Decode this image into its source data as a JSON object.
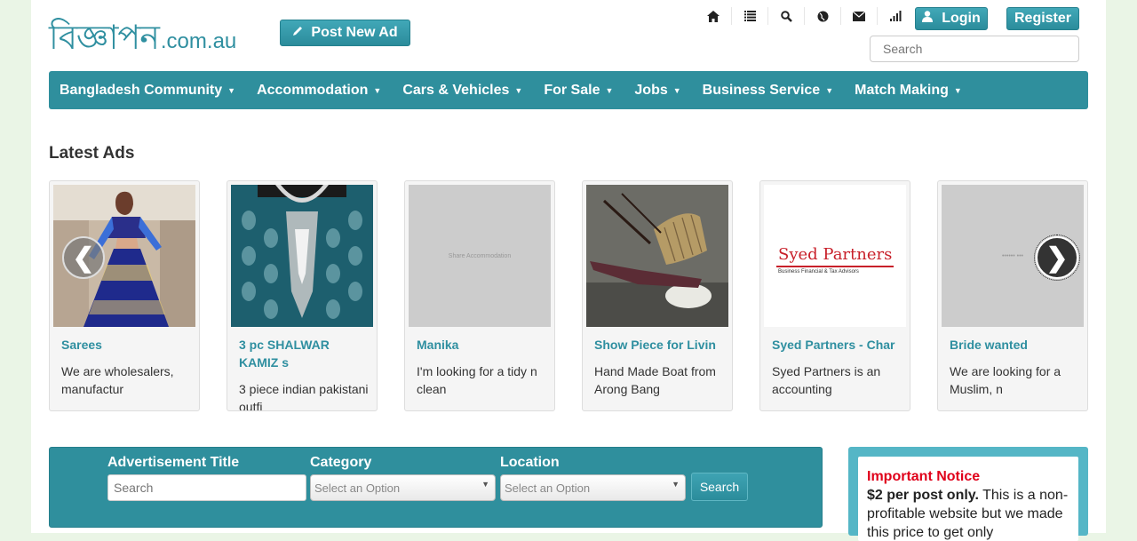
{
  "header": {
    "logo_bengali": "বিজ্ঞাপন",
    "logo_domain": ".com.au",
    "post_ad_label": "Post New Ad",
    "login_label": "Login",
    "register_label": "Register",
    "search_placeholder": "Search",
    "icons": [
      "home-icon",
      "list-icon",
      "search-icon",
      "globe-icon",
      "mail-icon",
      "signal-icon"
    ]
  },
  "nav": {
    "items": [
      {
        "label": "Bangladesh Community"
      },
      {
        "label": "Accommodation"
      },
      {
        "label": "Cars & Vehicles"
      },
      {
        "label": "For Sale"
      },
      {
        "label": "Jobs"
      },
      {
        "label": "Business Service"
      },
      {
        "label": "Match Making"
      }
    ]
  },
  "latest": {
    "title": "Latest Ads",
    "ads": [
      {
        "title": "Sarees",
        "desc": "We are wholesalers, manufactur"
      },
      {
        "title": "3 pc SHALWAR KAMIZ s",
        "desc": "3 piece indian pakistani outfi"
      },
      {
        "title": "Manika",
        "desc": "I'm looking for a tidy n clean",
        "image_text": "Share Accommodation"
      },
      {
        "title": "Show Piece for Livin",
        "desc": "Hand Made Boat from Arong Bang"
      },
      {
        "title": "Syed Partners - Char",
        "desc": "Syed Partners is an accounting",
        "logo_main": "Syed Partners",
        "logo_sub": "Business Financial & Tax Advisors"
      },
      {
        "title": "Bride wanted",
        "desc": "We are looking for a Muslim, n",
        "image_text": "•••••• •••"
      }
    ]
  },
  "search_panel": {
    "title_label": "Advertisement Title",
    "title_placeholder": "Search",
    "category_label": "Category",
    "category_value": "Select an Option",
    "location_label": "Location",
    "location_value": "Select an Option",
    "button_label": "Search"
  },
  "notice": {
    "heading": "Important Notice",
    "bold": "$2 per post only.",
    "text": " This is a non-profitable website but we made this price to get only"
  },
  "colors": {
    "teal": "#2f8f9d",
    "link": "#2f8fa0",
    "notice_red": "#e0001a",
    "page_bg": "#eaf5e6"
  }
}
